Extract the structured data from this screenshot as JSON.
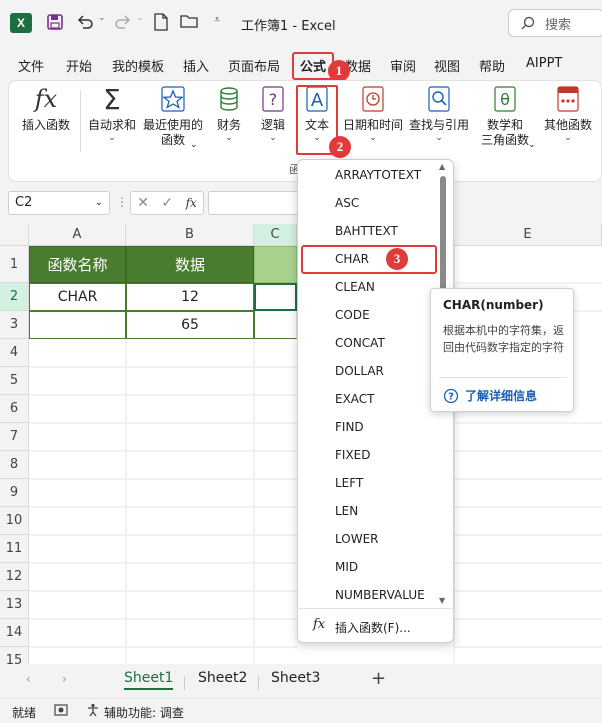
{
  "titlebar": {
    "title": "工作簿1 - Excel",
    "search_label": "搜索"
  },
  "menu": [
    "文件",
    "开始",
    "我的模板",
    "插入",
    "页面布局",
    "公式",
    "数据",
    "审阅",
    "视图",
    "帮助",
    "AIPPT"
  ],
  "ribbon": {
    "insert_function": "插入函数",
    "autosum": "自动求和",
    "recent_line1": "最近使用的",
    "recent_line2": "函数",
    "financial": "财务",
    "logical": "逻辑",
    "text": "文本",
    "datetime": "日期和时间",
    "lookup": "查找与引用",
    "math_line1": "数学和",
    "math_line2": "三角函数",
    "more": "其他函数",
    "group_label_partial": "函"
  },
  "formula_bar": {
    "name_box": "C2",
    "fx": "fx"
  },
  "grid": {
    "columns": [
      "A",
      "B",
      "C",
      "E"
    ],
    "rows": [
      "1",
      "2",
      "3",
      "4",
      "5",
      "6",
      "7",
      "8",
      "9",
      "10",
      "11",
      "12",
      "13",
      "14",
      "15"
    ],
    "header_a": "函数名称",
    "header_b": "数据",
    "a2": "CHAR",
    "b2": "12",
    "b3": "65"
  },
  "dropdown": {
    "items": [
      "ARRAYTOTEXT",
      "ASC",
      "BAHTTEXT",
      "CHAR",
      "CLEAN",
      "CODE",
      "CONCAT",
      "DOLLAR",
      "EXACT",
      "FIND",
      "FIXED",
      "LEFT",
      "LEN",
      "LOWER",
      "MID",
      "NUMBERVALUE"
    ],
    "footer": "插入函数(F)..."
  },
  "tooltip": {
    "title": "CHAR(number)",
    "description": "根据本机中的字符集，返回由代码数字指定的字符",
    "link": "了解详细信息"
  },
  "sheets": [
    "Sheet1",
    "Sheet2",
    "Sheet3"
  ],
  "status": {
    "ready": "就绪",
    "accessibility": "辅助功能: 调查"
  },
  "badges": [
    "1",
    "2",
    "3"
  ],
  "colors": {
    "excel_green": "#1d6f42",
    "header_dark_green": "#4a7c2f",
    "header_light_green": "#a9d18e",
    "highlight_red": "#e03a3a",
    "link_blue": "#1a5fb4"
  }
}
